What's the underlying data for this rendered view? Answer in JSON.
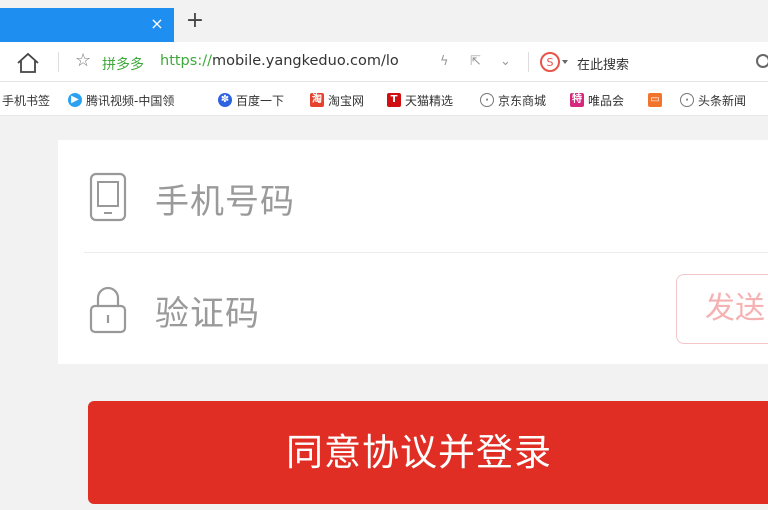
{
  "browser": {
    "tab_close": "×",
    "new_tab": "+",
    "site_name": "拼多多",
    "url_proto": "https://",
    "url_rest": "mobile.yangkeduo.com/lo",
    "search_placeholder": "在此搜索"
  },
  "bookmarks": [
    {
      "label": "手机书签",
      "icon": "none"
    },
    {
      "label": "腾讯视频-中国领",
      "icon": "play-icon"
    },
    {
      "label": "百度一下",
      "icon": "paw-icon"
    },
    {
      "label": "淘宝网",
      "icon": "taobao-icon"
    },
    {
      "label": "天猫精选",
      "icon": "tmall-icon"
    },
    {
      "label": "京东商城",
      "icon": "globe-icon"
    },
    {
      "label": "唯品会",
      "icon": "vip-icon"
    },
    {
      "label": "",
      "icon": "chat-icon"
    },
    {
      "label": "头条新闻",
      "icon": "globe-icon"
    }
  ],
  "login": {
    "phone_placeholder": "手机号码",
    "code_placeholder": "验证码",
    "send_code_label": "发送",
    "submit_label": "同意协议并登录"
  },
  "colors": {
    "tab_active": "#1f8ef1",
    "brand_green": "#3ea93a",
    "primary_red": "#e02e24",
    "placeholder_gray": "#9a9a9a"
  }
}
